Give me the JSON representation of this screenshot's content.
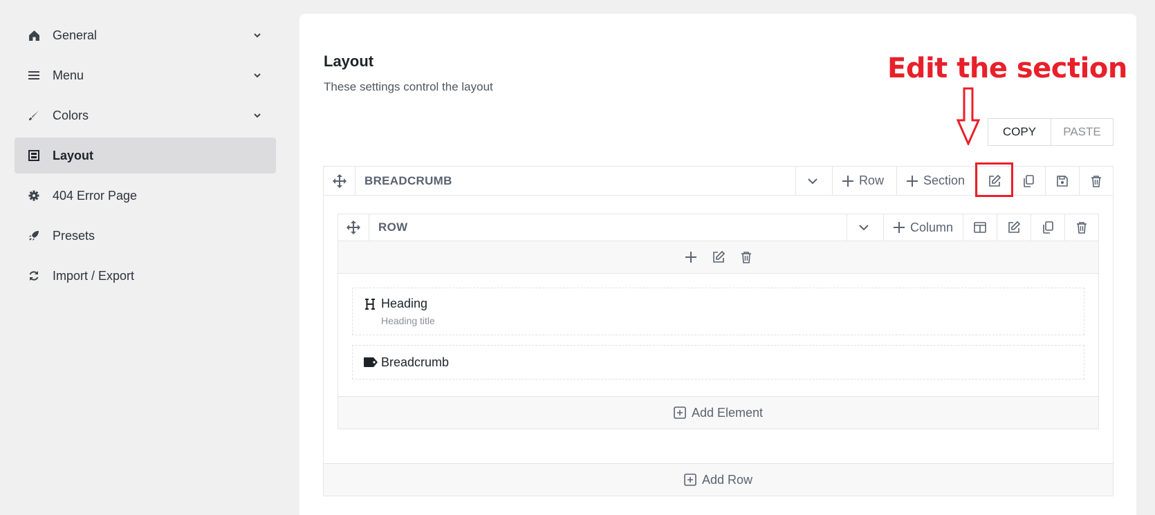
{
  "sidebar": {
    "items": [
      {
        "label": "General",
        "icon": "home-icon"
      },
      {
        "label": "Menu",
        "icon": "menu-icon"
      },
      {
        "label": "Colors",
        "icon": "brush-icon"
      },
      {
        "label": "Layout",
        "icon": "layout-icon",
        "active": true
      },
      {
        "label": "404 Error Page",
        "icon": "gear-icon"
      },
      {
        "label": "Presets",
        "icon": "rocket-icon"
      },
      {
        "label": "Import / Export",
        "icon": "refresh-icon"
      }
    ]
  },
  "main": {
    "title": "Layout",
    "description": "These settings control the layout",
    "copy_label": "COPY",
    "paste_label": "PASTE",
    "annotation": "Edit the section",
    "section": {
      "title": "BREADCRUMB",
      "row_label": "Row",
      "section_label": "Section",
      "add_row_label": "Add Row",
      "row": {
        "title": "ROW",
        "column_label": "Column",
        "add_element_label": "Add Element",
        "elements": [
          {
            "name": "Heading",
            "subtitle": "Heading title",
            "icon": "heading-icon"
          },
          {
            "name": "Breadcrumb",
            "icon": "tag-icon"
          }
        ]
      }
    }
  },
  "colors": {
    "accent_red": "#e8202a",
    "active_bg": "#dcdcde"
  }
}
